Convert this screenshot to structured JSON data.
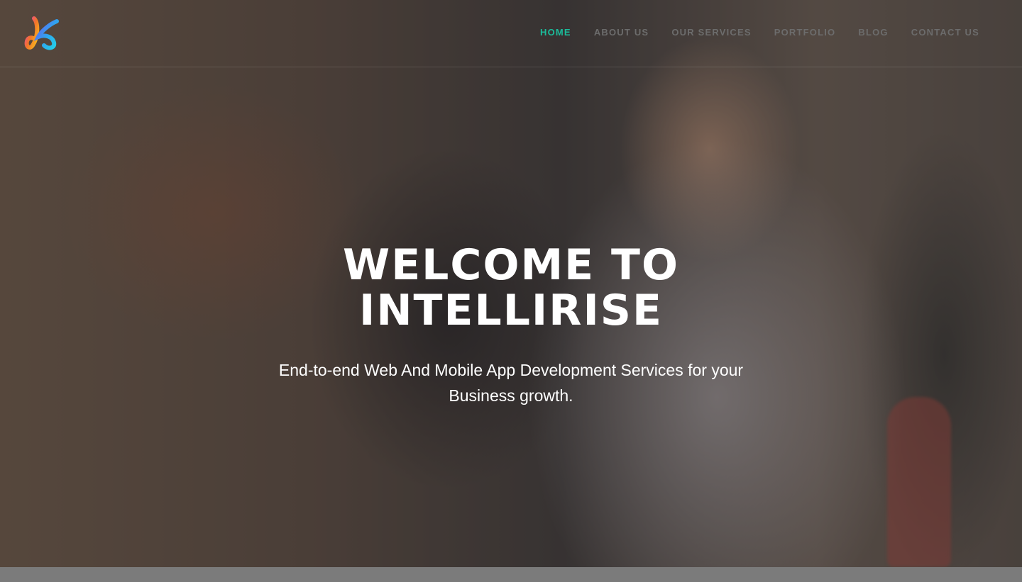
{
  "brand": {
    "logo_icon": "intellirise-logo-icon",
    "accent": "#1bbc9b"
  },
  "nav": {
    "items": [
      {
        "label": "HOME",
        "active": true
      },
      {
        "label": "ABOUT US",
        "active": false
      },
      {
        "label": "OUR SERVICES",
        "active": false
      },
      {
        "label": "PORTFOLIO",
        "active": false
      },
      {
        "label": "BLOG",
        "active": false
      },
      {
        "label": "CONTACT US",
        "active": false
      }
    ]
  },
  "hero": {
    "title_line1": "WELCOME TO",
    "title_line2": "INTELLIRISE",
    "subtitle": "End-to-end Web And Mobile App Development Services for your Business growth."
  }
}
